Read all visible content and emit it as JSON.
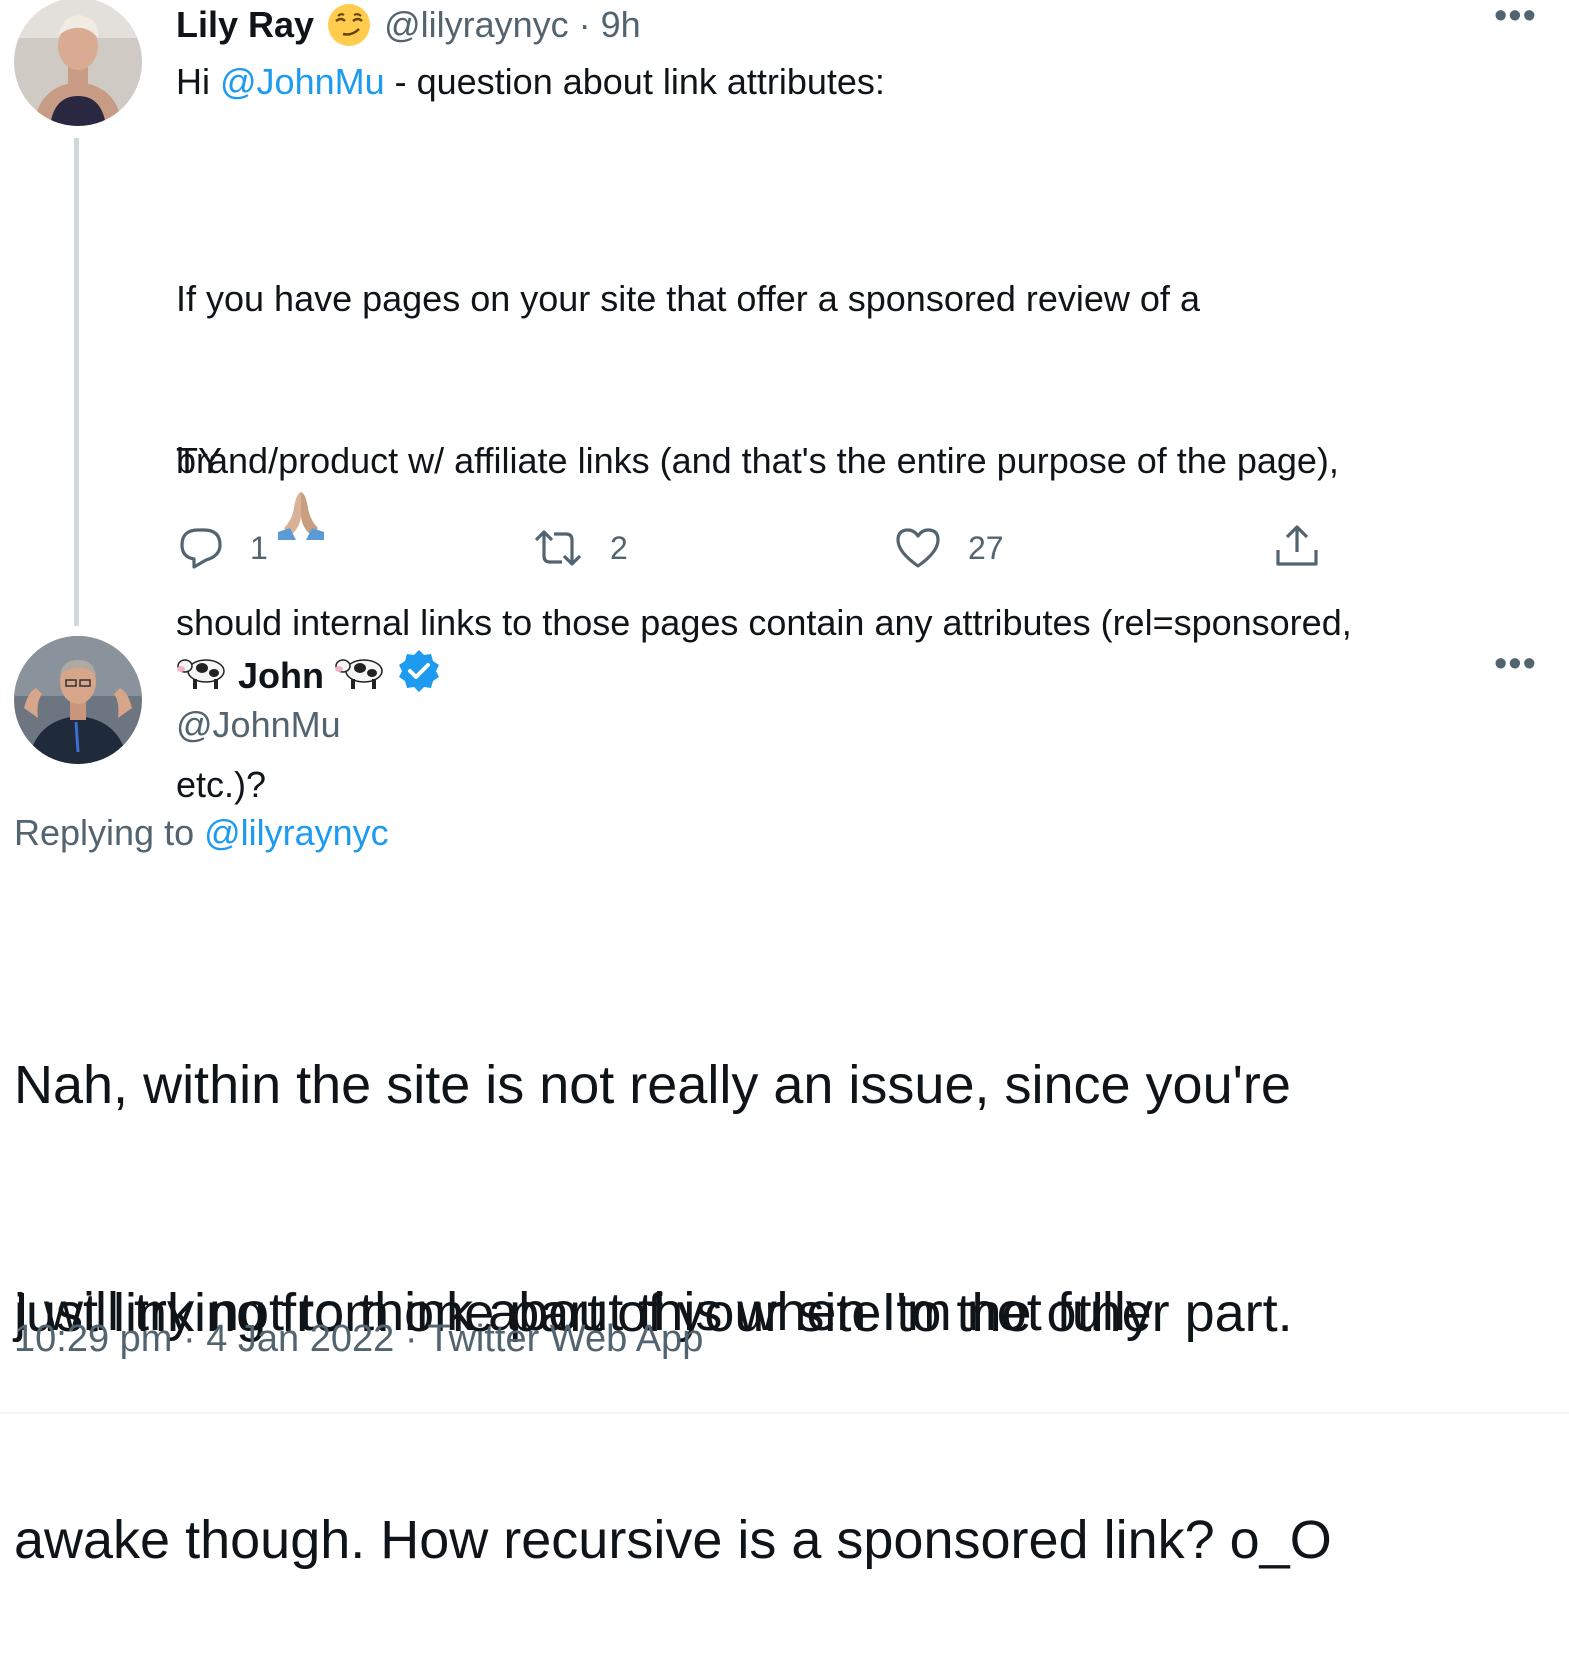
{
  "tweet1": {
    "name": "Lily Ray",
    "handle": "@lilyraynyc",
    "time": "9h",
    "line1_prefix": "Hi ",
    "line1_mention": "@JohnMu",
    "line1_suffix": " - question about link attributes:",
    "para1": [
      "If you have pages on your site that offer a sponsored review of a",
      "brand/product w/ affiliate links (and that's the entire purpose of the page),",
      "should internal links to those pages contain any attributes (rel=sponsored,",
      "etc.)?"
    ],
    "closing": "TY",
    "actions": {
      "replies": "1",
      "retweets": "2",
      "likes": "27"
    }
  },
  "tweet2": {
    "name": "John",
    "handle": "@JohnMu",
    "replying_label": "Replying to ",
    "replying_to": "@lilyraynyc",
    "para1": [
      "Nah, within the site is not really an issue, since you're",
      "just linking from one part of your site to the other part."
    ],
    "para2": [
      "I will try not to think about this when I'm not fully",
      "awake though. How recursive is a sponsored link? o_O"
    ],
    "timestamp": "10:29 pm · 4 Jan 2022 · Twitter Web App"
  },
  "icons": [
    "smirk-emoji-icon",
    "more-icon",
    "reply-icon",
    "retweet-icon",
    "like-icon",
    "share-icon",
    "cow-emoji-icon",
    "verified-badge-icon",
    "folded-hands-emoji-icon"
  ],
  "colors": {
    "link": "#1d9bf0",
    "muted": "#536471",
    "text": "#0f1419",
    "thread_line": "#cfd9de"
  }
}
